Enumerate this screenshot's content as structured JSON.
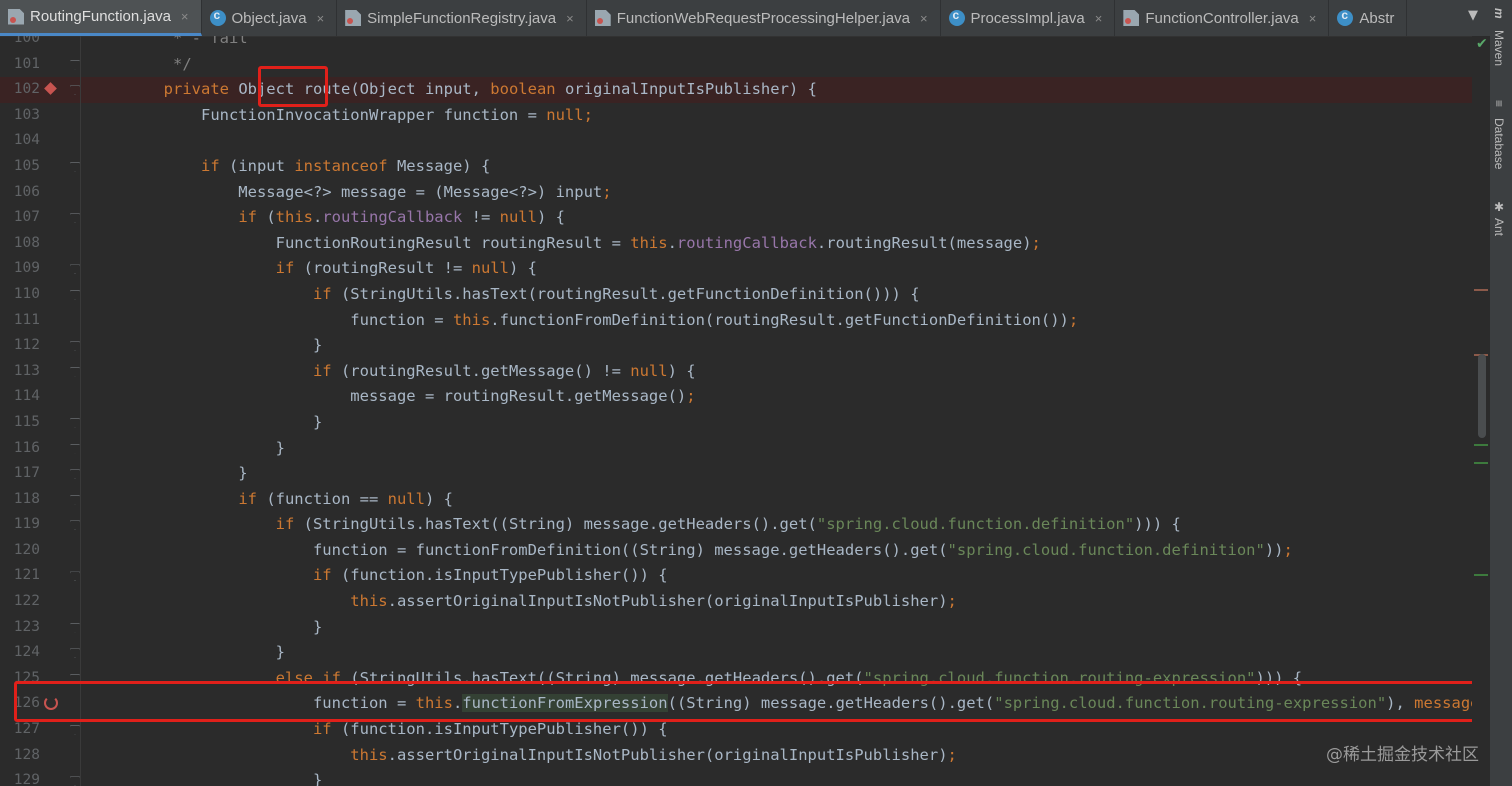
{
  "tabs": [
    {
      "label": "RoutingFunction.java",
      "icon": "java-file-icon",
      "active": true
    },
    {
      "label": "Object.java",
      "icon": "class-icon",
      "active": false
    },
    {
      "label": "SimpleFunctionRegistry.java",
      "icon": "java-file-icon",
      "active": false
    },
    {
      "label": "FunctionWebRequestProcessingHelper.java",
      "icon": "java-file-icon",
      "active": false
    },
    {
      "label": "ProcessImpl.java",
      "icon": "class-icon",
      "active": false
    },
    {
      "label": "FunctionController.java",
      "icon": "java-file-icon",
      "active": false
    },
    {
      "label": "Abstr",
      "icon": "class-icon",
      "active": false
    }
  ],
  "tool_windows": [
    "Maven",
    "Database",
    "Ant"
  ],
  "watermark": "@稀土掘金技术社区",
  "code_lines": [
    {
      "n": "100",
      "tokens": [
        [
          "cm",
          "         * - fail"
        ]
      ]
    },
    {
      "n": "101",
      "tokens": [
        [
          "cm",
          "         */"
        ]
      ]
    },
    {
      "n": "102",
      "bp": true,
      "tokens": [
        [
          "t",
          "        "
        ],
        [
          "kw",
          "private "
        ],
        [
          "t",
          "Object "
        ],
        [
          "t",
          "route"
        ],
        [
          "t",
          "(Object input, "
        ],
        [
          "kw",
          "boolean "
        ],
        [
          "t",
          "originalInputIsPublisher) {"
        ]
      ]
    },
    {
      "n": "103",
      "tokens": [
        [
          "t",
          "            FunctionInvocationWrapper function = "
        ],
        [
          "kw",
          "null"
        ],
        [
          "kw",
          ";"
        ]
      ]
    },
    {
      "n": "104",
      "tokens": [
        [
          "t",
          " "
        ]
      ]
    },
    {
      "n": "105",
      "tokens": [
        [
          "t",
          "            "
        ],
        [
          "kw",
          "if "
        ],
        [
          "t",
          "(input "
        ],
        [
          "kw",
          "instanceof "
        ],
        [
          "t",
          "Message) {"
        ]
      ]
    },
    {
      "n": "106",
      "tokens": [
        [
          "t",
          "                Message<?> message = (Message<?>) input"
        ],
        [
          "kw",
          ";"
        ]
      ]
    },
    {
      "n": "107",
      "tokens": [
        [
          "t",
          "                "
        ],
        [
          "kw",
          "if "
        ],
        [
          "t",
          "("
        ],
        [
          "kw",
          "this"
        ],
        [
          "t",
          "."
        ],
        [
          "fn",
          "routingCallback"
        ],
        [
          "t",
          " != "
        ],
        [
          "kw",
          "null"
        ],
        [
          "t",
          ") {"
        ]
      ]
    },
    {
      "n": "108",
      "tokens": [
        [
          "t",
          "                    FunctionRoutingResult routingResult = "
        ],
        [
          "kw",
          "this"
        ],
        [
          "t",
          "."
        ],
        [
          "fn",
          "routingCallback"
        ],
        [
          "t",
          ".routingResult(message)"
        ],
        [
          "kw",
          ";"
        ]
      ]
    },
    {
      "n": "109",
      "tokens": [
        [
          "t",
          "                    "
        ],
        [
          "kw",
          "if "
        ],
        [
          "t",
          "(routingResult != "
        ],
        [
          "kw",
          "null"
        ],
        [
          "t",
          ") {"
        ]
      ]
    },
    {
      "n": "110",
      "tokens": [
        [
          "t",
          "                        "
        ],
        [
          "kw",
          "if "
        ],
        [
          "t",
          "(StringUtils.hasText(routingResult.getFunctionDefinition())) {"
        ]
      ]
    },
    {
      "n": "111",
      "tokens": [
        [
          "t",
          "                            function = "
        ],
        [
          "kw",
          "this"
        ],
        [
          "t",
          ".functionFromDefinition(routingResult.getFunctionDefinition())"
        ],
        [
          "kw",
          ";"
        ]
      ]
    },
    {
      "n": "112",
      "tokens": [
        [
          "t",
          "                        }"
        ]
      ]
    },
    {
      "n": "113",
      "tokens": [
        [
          "t",
          "                        "
        ],
        [
          "kw",
          "if "
        ],
        [
          "t",
          "(routingResult.getMessage() != "
        ],
        [
          "kw",
          "null"
        ],
        [
          "t",
          ") {"
        ]
      ]
    },
    {
      "n": "114",
      "tokens": [
        [
          "t",
          "                            message = routingResult.getMessage()"
        ],
        [
          "kw",
          ";"
        ]
      ]
    },
    {
      "n": "115",
      "tokens": [
        [
          "t",
          "                        }"
        ]
      ]
    },
    {
      "n": "116",
      "tokens": [
        [
          "t",
          "                    }"
        ]
      ]
    },
    {
      "n": "117",
      "tokens": [
        [
          "t",
          "                }"
        ]
      ]
    },
    {
      "n": "118",
      "tokens": [
        [
          "t",
          "                "
        ],
        [
          "kw",
          "if "
        ],
        [
          "t",
          "(function == "
        ],
        [
          "kw",
          "null"
        ],
        [
          "t",
          ") {"
        ]
      ]
    },
    {
      "n": "119",
      "tokens": [
        [
          "t",
          "                    "
        ],
        [
          "kw",
          "if "
        ],
        [
          "t",
          "(StringUtils.hasText((String) message.getHeaders().get("
        ],
        [
          "st",
          "\"spring.cloud.function.definition\""
        ],
        [
          "t",
          "))) {"
        ]
      ]
    },
    {
      "n": "120",
      "tokens": [
        [
          "t",
          "                        function = functionFromDefinition((String) message.getHeaders().get("
        ],
        [
          "st",
          "\"spring.cloud.function.definition\""
        ],
        [
          "t",
          "))"
        ],
        [
          "kw",
          ";"
        ]
      ]
    },
    {
      "n": "121",
      "tokens": [
        [
          "t",
          "                        "
        ],
        [
          "kw",
          "if "
        ],
        [
          "t",
          "(function.isInputTypePublisher()) {"
        ]
      ]
    },
    {
      "n": "122",
      "tokens": [
        [
          "t",
          "                            "
        ],
        [
          "kw",
          "this"
        ],
        [
          "t",
          ".assertOriginalInputIsNotPublisher(originalInputIsPublisher)"
        ],
        [
          "kw",
          ";"
        ]
      ]
    },
    {
      "n": "123",
      "tokens": [
        [
          "t",
          "                        }"
        ]
      ]
    },
    {
      "n": "124",
      "tokens": [
        [
          "t",
          "                    }"
        ]
      ]
    },
    {
      "n": "125",
      "tokens": [
        [
          "t",
          "                    "
        ],
        [
          "kw",
          "else if "
        ],
        [
          "t",
          "(StringUtils.hasText((String) message.getHeaders().get("
        ],
        [
          "st",
          "\"spring.cloud.function.routing-expression\""
        ],
        [
          "t",
          "))) {"
        ]
      ]
    },
    {
      "n": "126",
      "re": true,
      "tokens": [
        [
          "t",
          "                        function = "
        ],
        [
          "kw",
          "this"
        ],
        [
          "t",
          "."
        ],
        [
          "hl",
          "functionFromExpression"
        ],
        [
          "t",
          "((String) message.getHeaders().get("
        ],
        [
          "st",
          "\"spring.cloud.function.routing-expression\""
        ],
        [
          "t",
          "), "
        ],
        [
          "kw",
          "message"
        ]
      ]
    },
    {
      "n": "127",
      "tokens": [
        [
          "t",
          "                        "
        ],
        [
          "kw",
          "if "
        ],
        [
          "t",
          "(function.isInputTypePublisher()) {"
        ]
      ]
    },
    {
      "n": "128",
      "tokens": [
        [
          "t",
          "                            "
        ],
        [
          "kw",
          "this"
        ],
        [
          "t",
          ".assertOriginalInputIsNotPublisher(originalInputIsPublisher)"
        ],
        [
          "kw",
          ";"
        ]
      ]
    },
    {
      "n": "129",
      "tokens": [
        [
          "t",
          "                        }"
        ]
      ]
    }
  ],
  "colors": {
    "background": "#2b2b2b",
    "keyword": "#cc7832",
    "string": "#6a8759",
    "field": "#9876aa",
    "default_text": "#a9b7c6",
    "annotation_box": "#e0201a"
  }
}
